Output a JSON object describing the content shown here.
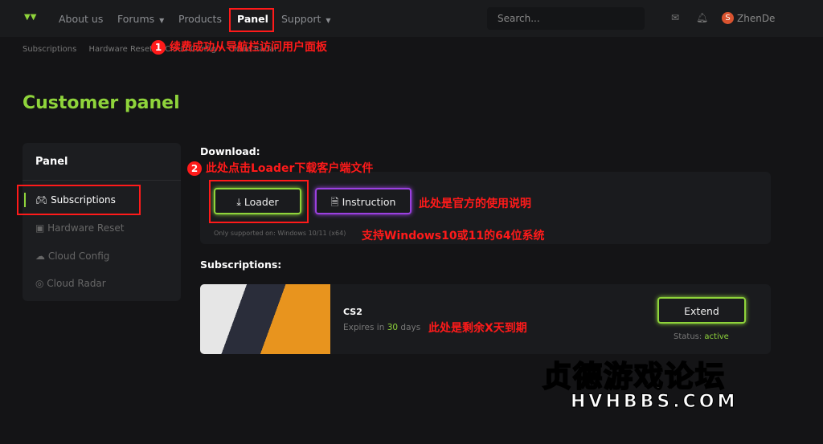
{
  "nav": {
    "items": [
      {
        "label": "About us"
      },
      {
        "label": "Forums",
        "dropdown": true
      },
      {
        "label": "Products"
      },
      {
        "label": "Panel",
        "active": true
      },
      {
        "label": "Support",
        "dropdown": true
      }
    ],
    "search_placeholder": "Search...",
    "user_initial": "S",
    "user_name": "ZhenDe"
  },
  "breadcrumbs": [
    "Subscriptions",
    "Hardware Reset",
    "Cloud Config",
    "Cloud Radar"
  ],
  "page_title": "Customer panel",
  "sidebar": {
    "heading": "Panel",
    "items": [
      {
        "label": "Subscriptions",
        "active": true
      },
      {
        "label": "Hardware Reset"
      },
      {
        "label": "Cloud Config"
      },
      {
        "label": "Cloud Radar"
      }
    ]
  },
  "download": {
    "heading": "Download:",
    "loader_label": "Loader",
    "instruction_label": "Instruction",
    "note": "Only supported on: Windows 10/11 (x64)"
  },
  "subscriptions": {
    "heading": "Subscriptions:",
    "items": [
      {
        "name": "CS2",
        "expires_prefix": "Expires in",
        "days": "30",
        "expires_suffix": "days",
        "extend_label": "Extend",
        "status_label": "Status:",
        "status": "active"
      }
    ]
  },
  "annotations": {
    "a1_num": "1",
    "a1": "续费成功从导航栏访问用户面板",
    "a2_num": "2",
    "a2": "此处点击Loader下载客户端文件",
    "a3": "此处是官方的使用说明",
    "a4": "支持Windows10或11的64位系统",
    "a5": "此处是剩余X天到期"
  },
  "watermark": {
    "title": "贞德游戏论坛",
    "site": "HVHBBS.COM"
  },
  "colors": {
    "accent": "#8fd43b",
    "instruction": "#9b40e0",
    "annotation": "#ff1a1a"
  }
}
